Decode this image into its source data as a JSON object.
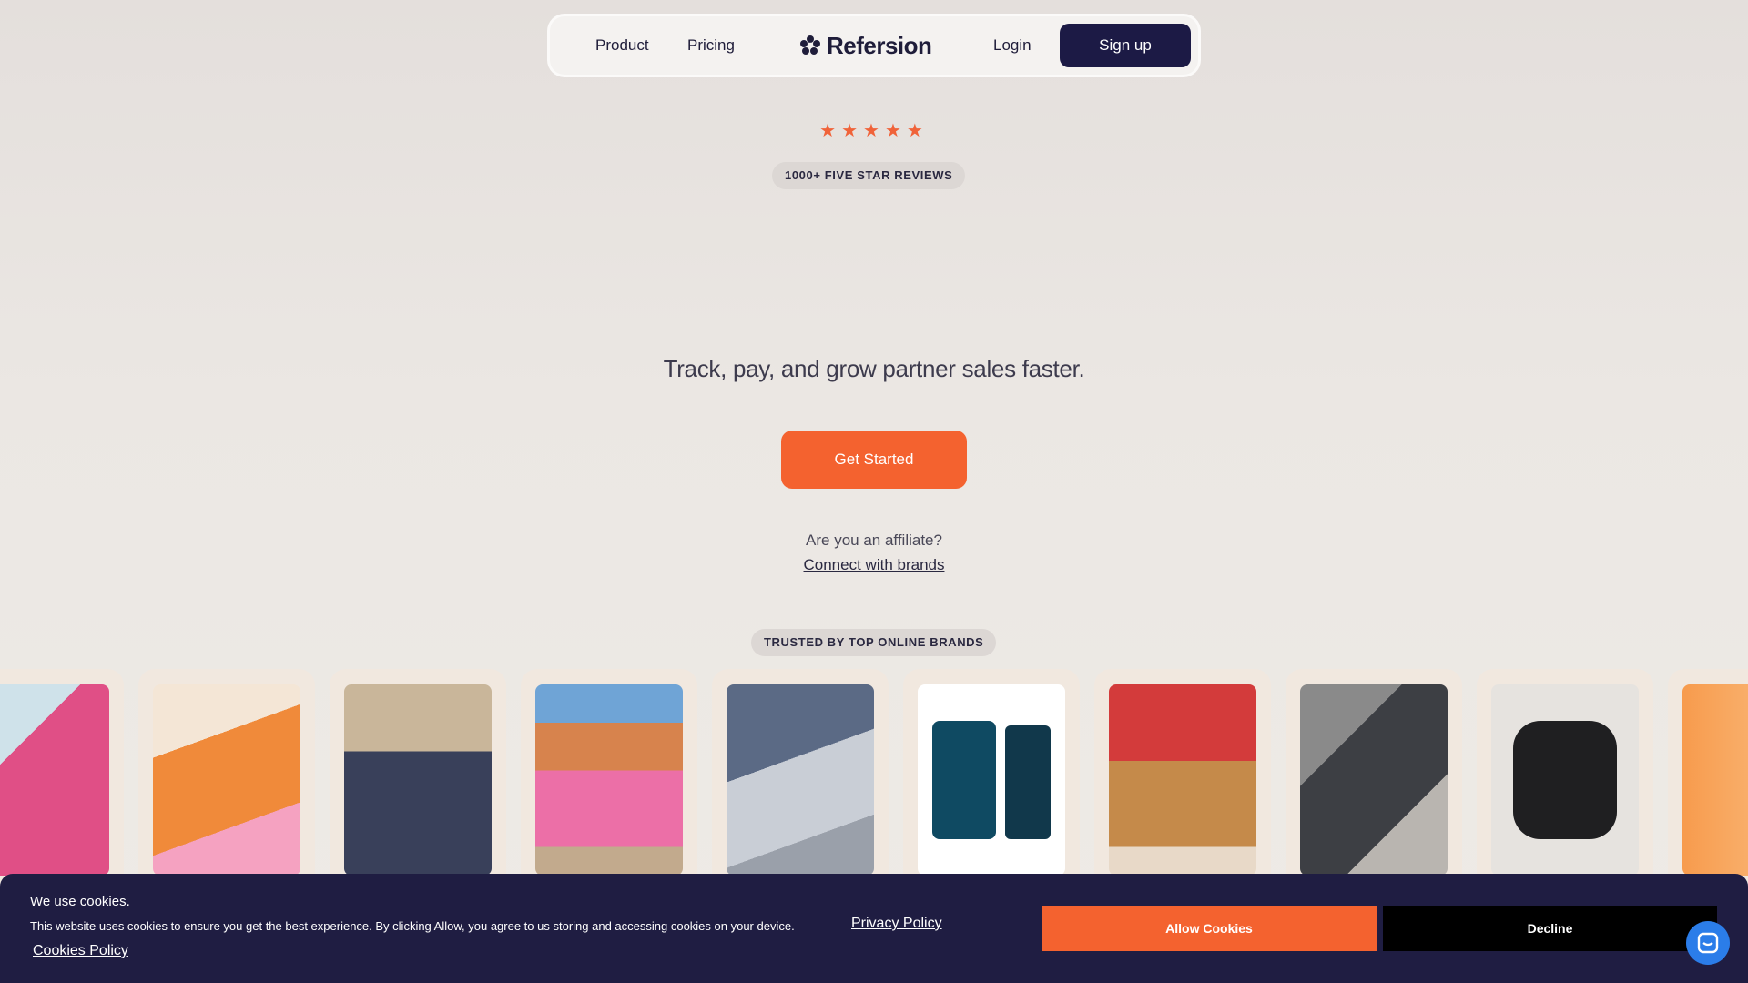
{
  "nav": {
    "product": "Product",
    "pricing": "Pricing",
    "brand": "Refersion",
    "login": "Login",
    "signup": "Sign up"
  },
  "hero": {
    "stars": "★★★★★",
    "reviews_badge": "1000+ FIVE STAR REVIEWS",
    "tagline": "Track, pay, and grow partner sales faster.",
    "cta": "Get Started",
    "affiliate_question": "Are you an affiliate?",
    "affiliate_link": "Connect with brands"
  },
  "trusted": {
    "badge": "TRUSTED BY TOP ONLINE BRANDS",
    "cards": [
      {
        "name": "alani-energy-can-card",
        "color": "#d9447b"
      },
      {
        "name": "orange-products-box-card",
        "color": "#ee8a3b"
      },
      {
        "name": "barstool-hats-card",
        "color": "#3f4456"
      },
      {
        "name": "pink-activewear-card",
        "color": "#e47ba4"
      },
      {
        "name": "skincare-kit-card",
        "color": "#8b95a6"
      },
      {
        "name": "energy-bits-card",
        "color": "#0f4a62"
      },
      {
        "name": "golden-retrievers-card",
        "color": "#c78a4b"
      },
      {
        "name": "appliance-box-card",
        "color": "#575a5f"
      },
      {
        "name": "pressure-cooker-card",
        "color": "#2b2b2b"
      },
      {
        "name": "orange-drink-card",
        "color": "#f7a55a"
      }
    ]
  },
  "cookie": {
    "title": "We use cookies.",
    "body": "This website uses cookies to ensure you get the best experience. By clicking Allow, you agree to us storing and accessing cookies on your device.",
    "privacy": "Privacy Policy",
    "cookies_policy": "Cookies Policy",
    "allow": "Allow Cookies",
    "decline": "Decline"
  },
  "colors": {
    "accent": "#f4622f",
    "navy": "#1c1a45"
  }
}
